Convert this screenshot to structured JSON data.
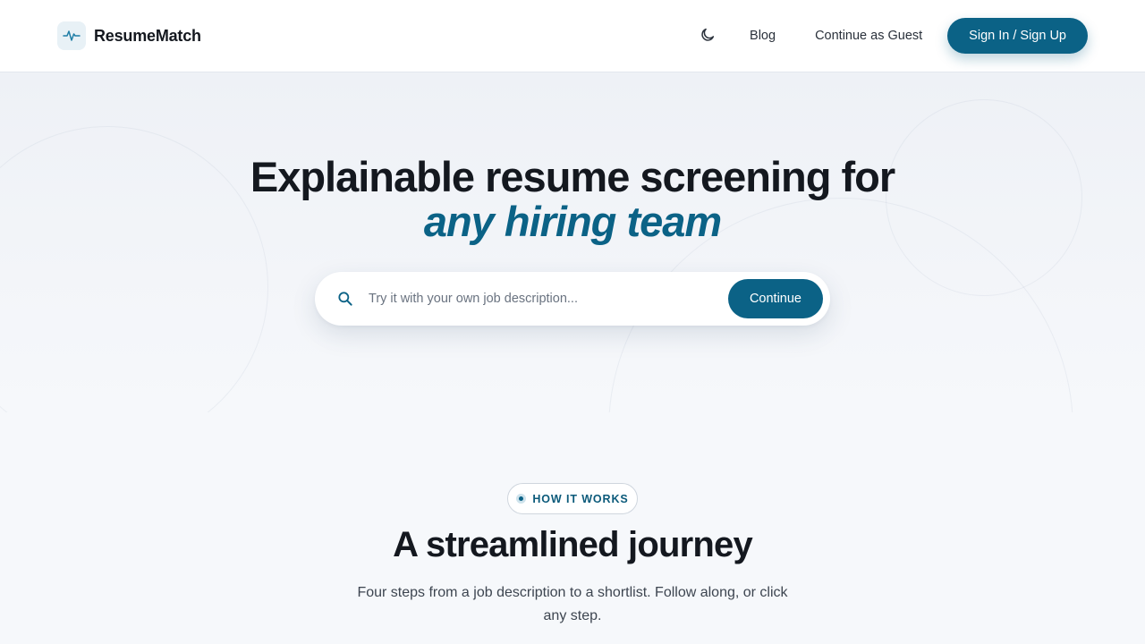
{
  "header": {
    "brand_name": "ResumeMatch",
    "nav": {
      "blog_label": "Blog",
      "guest_label": "Continue as Guest",
      "cta_label": "Sign In / Sign Up"
    }
  },
  "hero": {
    "title_line1": "Explainable resume screening for",
    "title_line2": "any hiring team",
    "search": {
      "placeholder": "Try it with your own job description...",
      "value": "",
      "button_label": "Continue"
    }
  },
  "how_it_works": {
    "pill_label": "HOW IT WORKS",
    "title": "A streamlined journey",
    "subtitle": "Four steps from a job description to a shortlist. Follow along, or click any step."
  },
  "colors": {
    "accent": "#0b6286",
    "text": "#14181f",
    "background": "#f6f8fb"
  },
  "icons": {
    "logo": "pulse-icon",
    "theme": "moon-icon",
    "search": "search-icon"
  }
}
